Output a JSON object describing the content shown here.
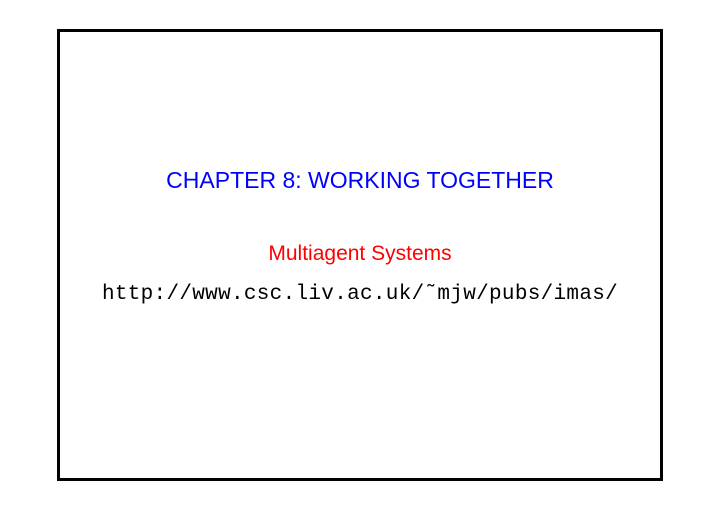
{
  "slide": {
    "chapter_title": "CHAPTER 8: WORKING TOGETHER",
    "subtitle": "Multiagent Systems",
    "url": "http://www.csc.liv.ac.uk/˜mjw/pubs/imas/"
  }
}
